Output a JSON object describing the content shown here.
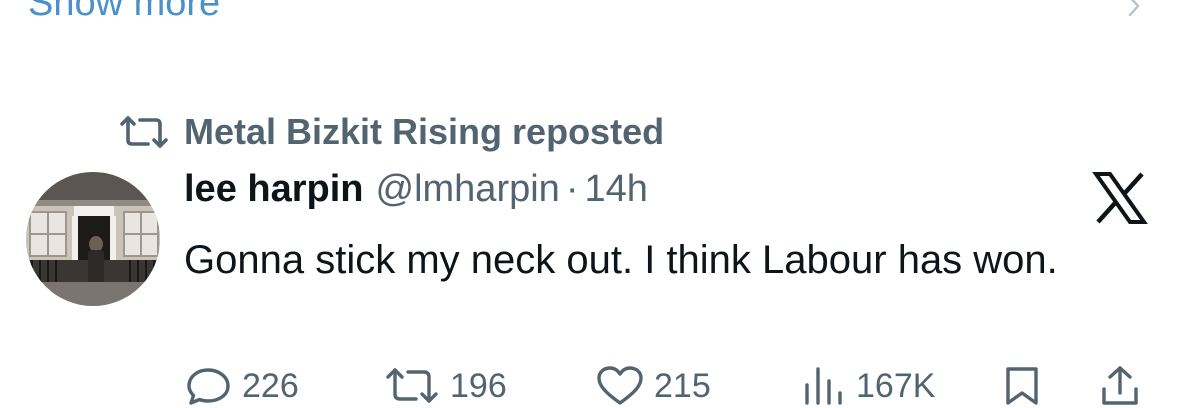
{
  "show_more": {
    "label": "Show more"
  },
  "repost_banner": {
    "text": "Metal Bizkit Rising reposted"
  },
  "tweet": {
    "display_name": "lee harpin",
    "handle": "@lmharpin",
    "separator": "·",
    "time": "14h",
    "text": "Gonna stick my neck out. I think Labour has won."
  },
  "actions": {
    "replies": "226",
    "reposts": "196",
    "likes": "215",
    "views": "167K"
  },
  "icons": {
    "repost": "repost-icon",
    "reply": "reply-icon",
    "like": "heart-icon",
    "views": "views-icon",
    "bookmark": "bookmark-icon",
    "share": "share-icon",
    "platform": "x-logo-icon",
    "chevron": "chevron-right-icon"
  },
  "colors": {
    "link": "#4a90c9",
    "secondary": "#536471",
    "primary_text": "#0f1419"
  }
}
